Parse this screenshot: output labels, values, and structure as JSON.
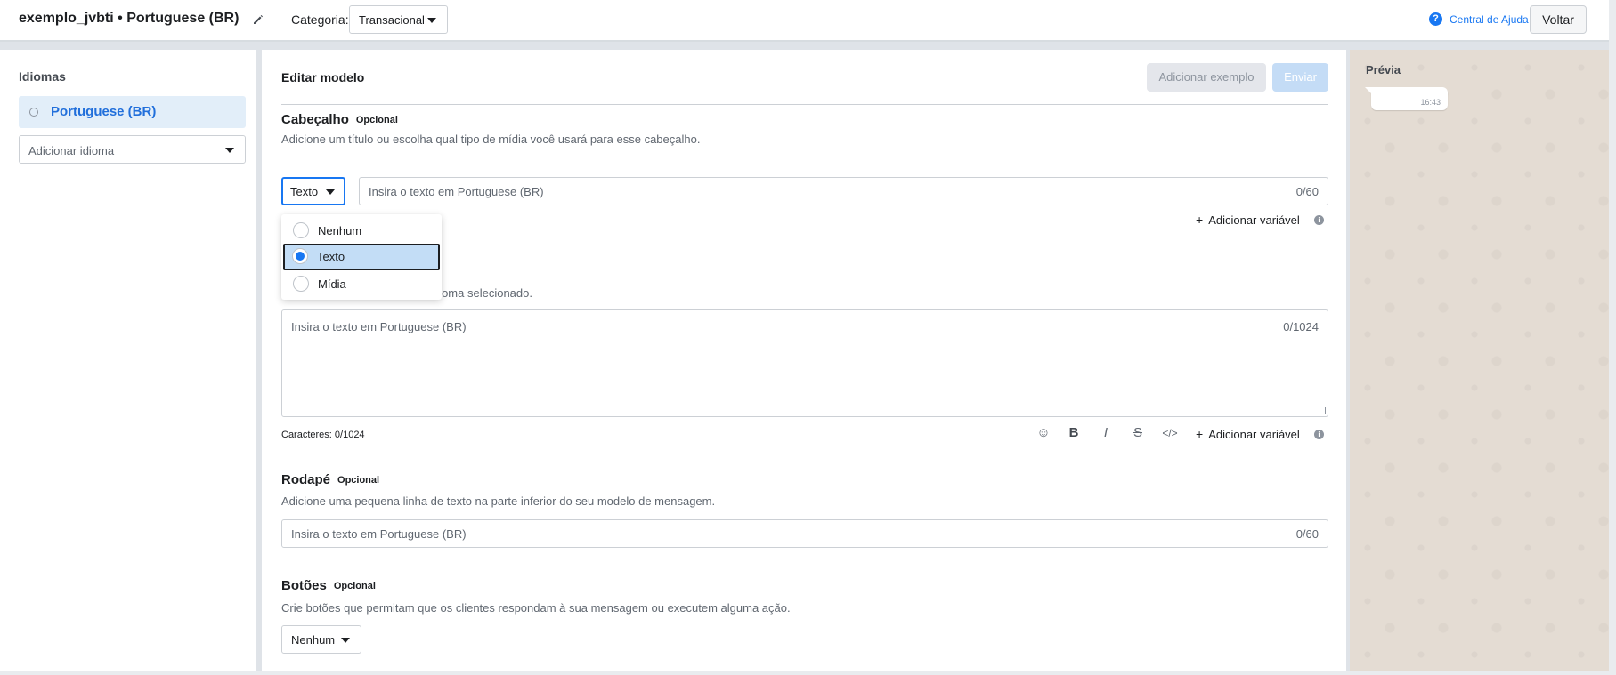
{
  "header": {
    "title": "exemplo_jvbti • Portuguese (BR)",
    "category_label": "Categoria:",
    "category_value": "Transacional",
    "help_label": "Central de Ajuda",
    "help_icon": "?",
    "back_label": "Voltar"
  },
  "languages": {
    "title": "Idiomas",
    "items": [
      {
        "label": "Portuguese (BR)"
      }
    ],
    "add_placeholder": "Adicionar idioma"
  },
  "editor": {
    "title": "Editar modelo",
    "add_example_label": "Adicionar exemplo",
    "send_label": "Enviar",
    "header_section": {
      "title": "Cabeçalho",
      "badge": "Opcional",
      "description": "Adicione um título ou escolha qual tipo de mídia você usará para esse cabeçalho.",
      "type_value": "Texto",
      "input_placeholder": "Insira o texto em Portuguese (BR)",
      "counter": "0/60",
      "add_variable_label": "Adicionar variável",
      "add_variable_plus": "+",
      "info_icon": "i"
    },
    "type_dropdown": {
      "options": [
        {
          "label": "Nenhum",
          "selected": false
        },
        {
          "label": "Texto",
          "selected": true
        },
        {
          "label": "Mídia",
          "selected": false
        }
      ]
    },
    "body_section": {
      "description_partial": "no idioma selecionado.",
      "input_placeholder": "Insira o texto em Portuguese (BR)",
      "counter": "0/1024",
      "chars_label": "Caracteres: 0/1024",
      "format_icons": {
        "emoji": "☺",
        "bold": "B",
        "italic": "I",
        "strike": "S",
        "code": "</>"
      },
      "add_variable_label": "Adicionar variável",
      "add_variable_plus": "+",
      "info_icon": "i"
    },
    "footer_section": {
      "title": "Rodapé",
      "badge": "Opcional",
      "description": "Adicione uma pequena linha de texto na parte inferior do seu modelo de mensagem.",
      "input_placeholder": "Insira o texto em Portuguese (BR)",
      "counter": "0/60"
    },
    "buttons_section": {
      "title": "Botões",
      "badge": "Opcional",
      "description": "Crie botões que permitam que os clientes respondam à sua mensagem ou executem alguma ação.",
      "select_value": "Nenhum"
    }
  },
  "preview": {
    "title": "Prévia",
    "message_time": "16:43"
  },
  "colors": {
    "accent": "#1877f2",
    "selected_bg": "#e2eef9",
    "preview_bg": "#e4dcd3"
  }
}
